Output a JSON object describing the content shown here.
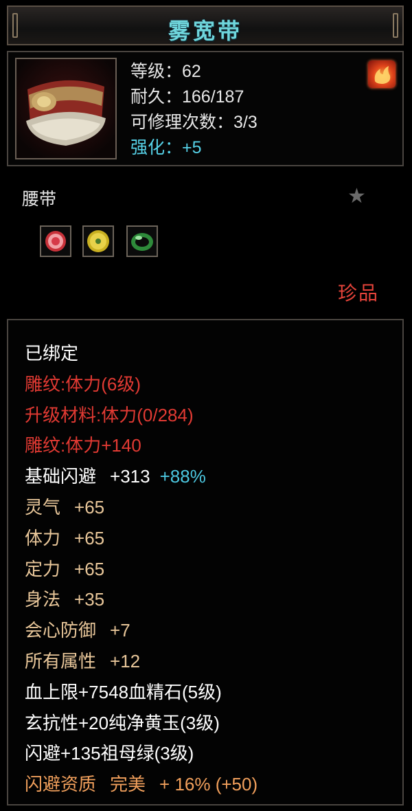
{
  "item": {
    "name": "雾宽带",
    "stats": {
      "level": "等级：62",
      "durability": "耐久：166/187",
      "repair": "可修理次数：3/3",
      "enhance": "强化：+5"
    },
    "type": "腰带",
    "rarity": "珍品",
    "gems": [
      "red-gem-icon",
      "yellow-jade-icon",
      "green-emerald-icon"
    ]
  },
  "attributes": {
    "bound": "已绑定",
    "engrave1": "雕纹:体力(6级)",
    "upgrade": "升级材料:体力(0/284)",
    "engrave2": "雕纹:体力+140",
    "dodge_base_label": "基础闪避",
    "dodge_base_value": "+313",
    "dodge_base_pct": "+88%",
    "lingqi_label": "灵气",
    "lingqi_value": "+65",
    "tili_label": "体力",
    "tili_value": "+65",
    "dingli_label": "定力",
    "dingli_value": "+65",
    "shenfa_label": "身法",
    "shenfa_value": "+35",
    "crit_def_label": "会心防御",
    "crit_def_value": "+7",
    "all_attr_label": "所有属性",
    "all_attr_value": "+12",
    "gem1": "血上限+7548血精石(5级)",
    "gem2": "玄抗性+20纯净黄玉(3级)",
    "gem3": "闪避+135祖母绿(3级)",
    "quality_label": "闪避资质",
    "quality_grade": "完美",
    "quality_value": "+ 16% (+50)"
  },
  "colors": {
    "title": "#6fd6dc",
    "cyan": "#56d2e8",
    "red": "#e23a33",
    "tan": "#e9c79a",
    "orange": "#f2a05c",
    "rarity": "#e5433a"
  }
}
